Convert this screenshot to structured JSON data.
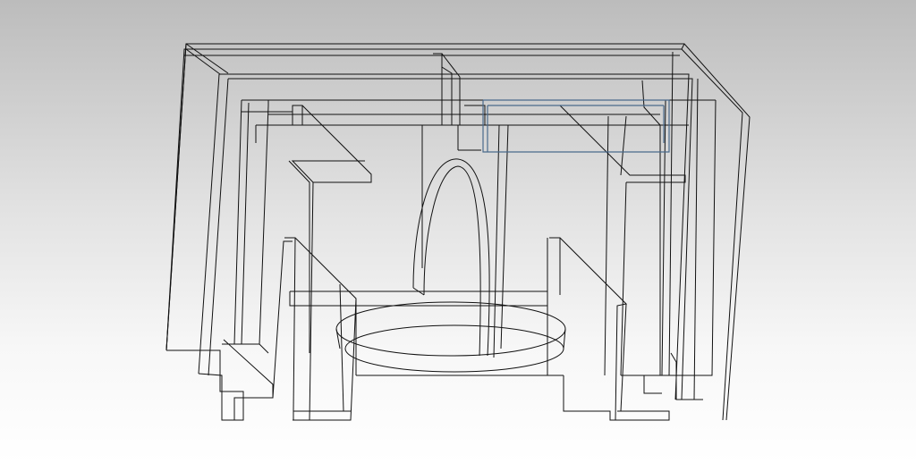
{
  "view": {
    "mode": "wireframe",
    "background_top": "#bcbcbc",
    "background_bottom": "#ffffff",
    "edge_color": "#111111",
    "selection_color": "#4a6a8c",
    "selected_part": "top-drawer-right"
  }
}
